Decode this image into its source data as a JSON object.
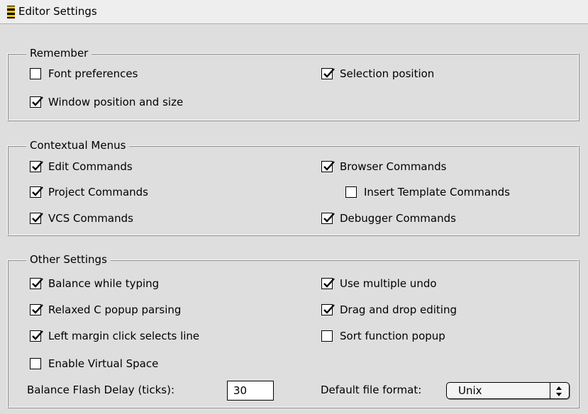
{
  "window": {
    "title": "Editor Settings"
  },
  "remember": {
    "title": "Remember",
    "font_preferences": {
      "label": "Font preferences",
      "checked": false
    },
    "window_position": {
      "label": "Window position and size",
      "checked": true
    },
    "selection_position": {
      "label": "Selection position",
      "checked": true
    }
  },
  "contextual_menus": {
    "title": "Contextual Menus",
    "edit_commands": {
      "label": "Edit Commands",
      "checked": true
    },
    "project_commands": {
      "label": "Project Commands",
      "checked": true
    },
    "vcs_commands": {
      "label": "VCS Commands",
      "checked": true
    },
    "browser_commands": {
      "label": "Browser Commands",
      "checked": true
    },
    "insert_template_commands": {
      "label": "Insert Template Commands",
      "checked": false
    },
    "debugger_commands": {
      "label": "Debugger Commands",
      "checked": true
    }
  },
  "other_settings": {
    "title": "Other Settings",
    "balance_while_typing": {
      "label": "Balance while typing",
      "checked": true
    },
    "relaxed_c_popup": {
      "label": "Relaxed C popup parsing",
      "checked": true
    },
    "left_margin_click": {
      "label": "Left margin click selects line",
      "checked": true
    },
    "enable_virtual_space": {
      "label": "Enable Virtual Space",
      "checked": false
    },
    "use_multiple_undo": {
      "label": "Use multiple undo",
      "checked": true
    },
    "drag_and_drop": {
      "label": "Drag and drop editing",
      "checked": true
    },
    "sort_function_popup": {
      "label": "Sort function popup",
      "checked": false
    },
    "balance_flash_delay": {
      "label": "Balance Flash Delay (ticks):",
      "value": "30"
    },
    "default_file_format": {
      "label": "Default file format:",
      "value": "Unix"
    }
  }
}
